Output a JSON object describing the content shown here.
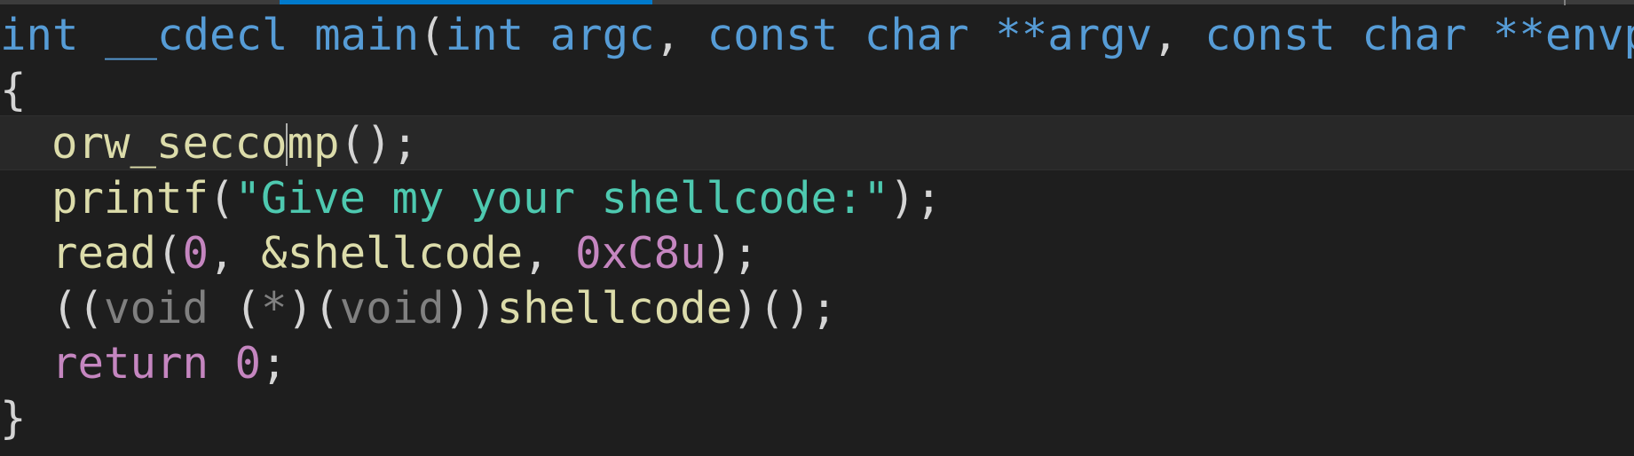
{
  "editor": {
    "colors": {
      "background": "#1e1e1e",
      "keyword": "#569cd6",
      "function": "#dcdcaa",
      "string": "#4ec9b0",
      "number": "#c586c0",
      "punctuation": "#d4d4d4",
      "dimmed": "#808080"
    },
    "lines": [
      {
        "kw_int": "int",
        "kw_cdecl": "__cdecl",
        "fn_main": "main",
        "paren_open": "(",
        "kw_int2": "int",
        "param_argc": "argc",
        "comma1": ",",
        "kw_const1": "const",
        "kw_char1": "char",
        "param_argv": "**argv",
        "comma2": ",",
        "kw_const2": "const",
        "kw_char2": "char",
        "param_envp": "**envp",
        "paren_close": ")"
      },
      {
        "brace": "{"
      },
      {
        "fn_before_cursor": "orw_secco",
        "fn_after_cursor": "mp",
        "call": "();"
      },
      {
        "fn": "printf",
        "open": "(",
        "string": "\"Give my your shellcode:\"",
        "close": ");"
      },
      {
        "fn": "read",
        "open": "(",
        "arg0": "0",
        "sep1": ", ",
        "arg1": "&shellcode",
        "sep2": ", ",
        "arg2": "0xC8u",
        "close": ");"
      },
      {
        "open1": "((",
        "void1": "void",
        "mid1": " (",
        "star": "*",
        "mid2": ")(",
        "void2": "void",
        "mid3": "))",
        "target": "shellcode",
        "close": ")();"
      },
      {
        "kw_return": "return",
        "value": "0",
        "semi": ";"
      },
      {
        "brace": "}"
      }
    ]
  }
}
